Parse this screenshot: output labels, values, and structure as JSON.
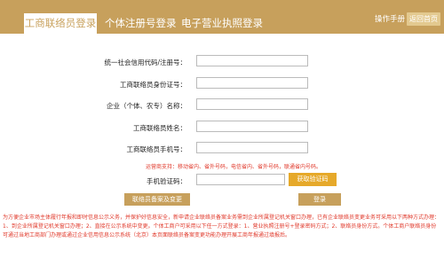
{
  "header": {
    "tabs": [
      {
        "label": "工商联络员登录"
      },
      {
        "label": "个体注册号登录"
      },
      {
        "label": "电子营业执照登录"
      }
    ],
    "manual_link": "操作手册",
    "back_button": "返回首页"
  },
  "form": {
    "fields": [
      {
        "label": "统一社会信用代码/注册号：",
        "value": ""
      },
      {
        "label": "工商联络员身份证号：",
        "value": ""
      },
      {
        "label": "企业（个体、农专）名称：",
        "value": ""
      },
      {
        "label": "工商联络员姓名：",
        "value": ""
      },
      {
        "label": "工商联络员手机号：",
        "value": ""
      }
    ],
    "phone_hint": "运营商支持：移动省内、省外号码，电信省内、省外号码，联通省内号码。",
    "code_label": "手机验证码：",
    "code_value": "",
    "get_code_button": "获取验证码",
    "change_button": "联络员备案及变更",
    "login_button": "登录"
  },
  "notice": "为方便企业市场主体履行年报和即时信息公示义务，并保护好信息安全，新申请企业联络员备案业务需到企业所属登记机关窗口办理，已有企业联络员变更业务可采用以下两种方式办理：1、到企业所属登记机关窗口办理；2、直接在公示系统中变更。个体工商户可采用以下任一方式登录：1、营业执照注册号+登录密码方式；2、联络员身份方式。个体工商户联络员身份可通过当地工商部门办理或通过企业信用信息公示系统（北京）本页面联络员备案变更功能办理开展工商年报通过填报后。"
}
